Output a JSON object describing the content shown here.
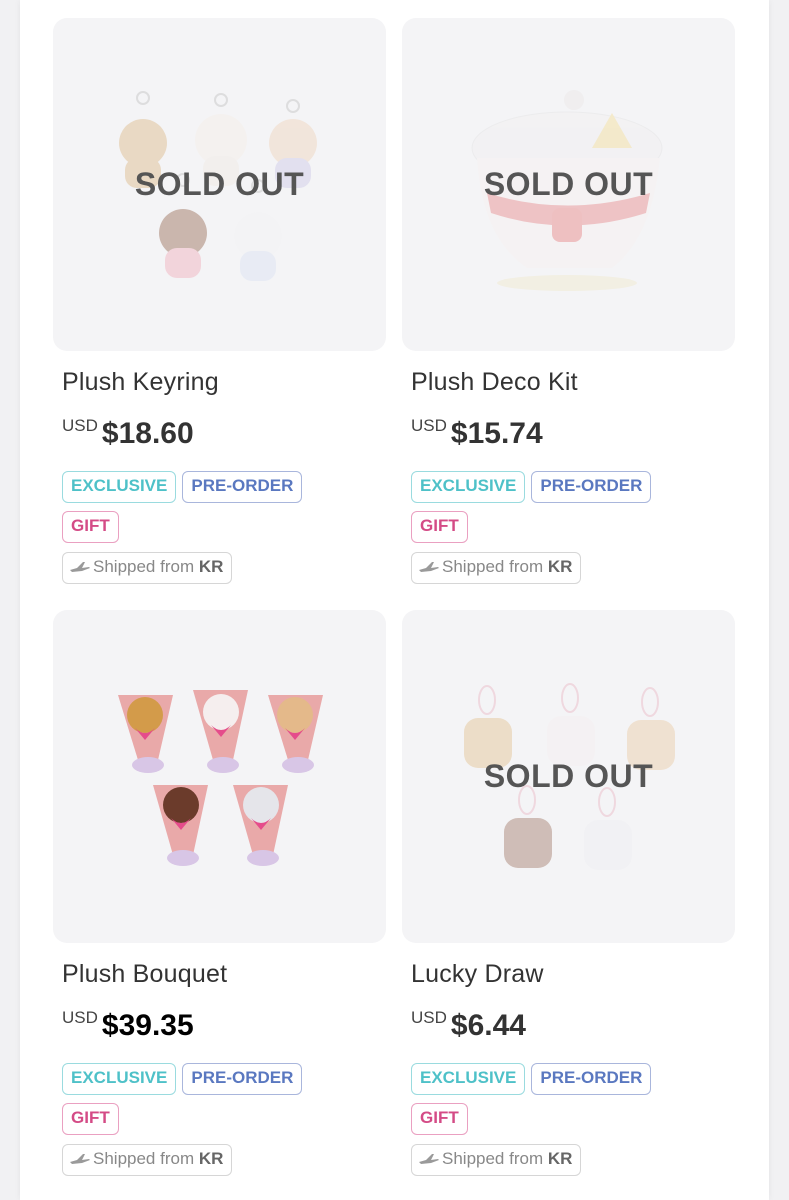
{
  "products": [
    {
      "title": "Plush Keyring",
      "currency": "USD",
      "price": "$18.60",
      "overlay": "SOLD OUT",
      "badges": {
        "exclusive": "EXCLUSIVE",
        "preorder": "PRE-ORDER",
        "gift": "GIFT"
      },
      "shipping": {
        "text": "Shipped from",
        "country": "KR"
      }
    },
    {
      "title": "Plush Deco Kit",
      "currency": "USD",
      "price": "$15.74",
      "overlay": "SOLD OUT",
      "badges": {
        "exclusive": "EXCLUSIVE",
        "preorder": "PRE-ORDER",
        "gift": "GIFT"
      },
      "shipping": {
        "text": "Shipped from",
        "country": "KR"
      }
    },
    {
      "title": "Plush Bouquet",
      "currency": "USD",
      "price": "$39.35",
      "overlay": "",
      "badges": {
        "exclusive": "EXCLUSIVE",
        "preorder": "PRE-ORDER",
        "gift": "GIFT"
      },
      "shipping": {
        "text": "Shipped from",
        "country": "KR"
      }
    },
    {
      "title": "Lucky Draw",
      "currency": "USD",
      "price": "$6.44",
      "overlay": "SOLD OUT",
      "badges": {
        "exclusive": "EXCLUSIVE",
        "preorder": "PRE-ORDER",
        "gift": "GIFT"
      },
      "shipping": {
        "text": "Shipped from",
        "country": "KR"
      }
    }
  ],
  "icons": {
    "shipping": "airplane-icon"
  },
  "colors": {
    "exclusive": "#4ec1c8",
    "preorder": "#5a78c0",
    "gift": "#d44b86",
    "soldout_text": "#555555"
  }
}
